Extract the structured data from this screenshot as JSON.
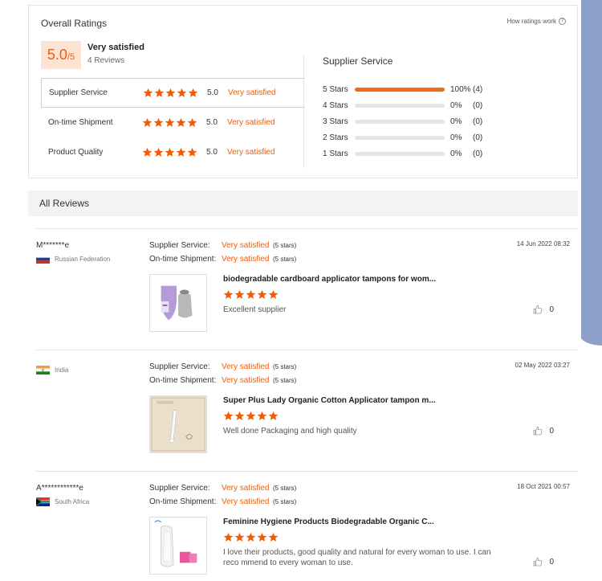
{
  "overall": {
    "title": "Overall Ratings",
    "how_link": "How ratings work",
    "score": "5.0",
    "score_out_of": "/5",
    "summary_label": "Very satisfied",
    "review_count": "4 Reviews",
    "categories": [
      {
        "name": "Supplier Service",
        "stars": 5,
        "score": "5.0",
        "desc": "Very satisfied"
      },
      {
        "name": "On-time Shipment",
        "stars": 5,
        "score": "5.0",
        "desc": "Very satisfied"
      },
      {
        "name": "Product Quality",
        "stars": 5,
        "score": "5.0",
        "desc": "Very satisfied"
      }
    ],
    "supplier_service_title": "Supplier Service",
    "breakdown": [
      {
        "label": "5 Stars",
        "fraction": 1.0,
        "pct": "100%",
        "count": "(4)"
      },
      {
        "label": "4 Stars",
        "fraction": 0,
        "pct": "0%",
        "count": "(0)"
      },
      {
        "label": "3 Stars",
        "fraction": 0,
        "pct": "0%",
        "count": "(0)"
      },
      {
        "label": "2 Stars",
        "fraction": 0,
        "pct": "0%",
        "count": "(0)"
      },
      {
        "label": "1 Stars",
        "fraction": 0,
        "pct": "0%",
        "count": "(0)"
      }
    ]
  },
  "all_reviews_title": "All Reviews",
  "reviews": [
    {
      "reviewer": "M*******e",
      "country": "Russian Federation",
      "flag": "russia-flag",
      "supplier_label": "Supplier Service:",
      "supplier_val": "Very satisfied",
      "supplier_stars": "(5 stars)",
      "shipment_label": "On-time Shipment:",
      "shipment_val": "Very satisfied",
      "shipment_stars": "(5 stars)",
      "date": "14 Jun 2022 08:32",
      "product": "biodegradable cardboard applicator tampons for wom...",
      "rating": 5,
      "text": "Excellent supplier",
      "likes": "0"
    },
    {
      "reviewer": "",
      "country": "India",
      "flag": "india-flag",
      "supplier_label": "Supplier Service:",
      "supplier_val": "Very satisfied",
      "supplier_stars": "(5 stars)",
      "shipment_label": "On-time Shipment:",
      "shipment_val": "Very satisfied",
      "shipment_stars": "(5 stars)",
      "date": "02 May 2022 03:27",
      "product": "Super Plus Lady Organic Cotton Applicator tampon m...",
      "rating": 5,
      "text": "Well done Packaging and high quality",
      "likes": "0"
    },
    {
      "reviewer": "A************e",
      "country": "South Africa",
      "flag": "south-africa-flag",
      "supplier_label": "Supplier Service:",
      "supplier_val": "Very satisfied",
      "supplier_stars": "(5 stars)",
      "shipment_label": "On-time Shipment:",
      "shipment_val": "Very satisfied",
      "shipment_stars": "(5 stars)",
      "date": "18 Oct 2021 00:57",
      "product": "Feminine Hygiene Products Biodegradable Organic C...",
      "rating": 5,
      "text": "I love their products, good quality and natural for every woman to use. I can reco mmend to every woman to use.",
      "likes": "0"
    }
  ],
  "colors": {
    "accent": "#f25c05",
    "score_bg": "#fde3d2",
    "side_panel": "#8da0c8"
  }
}
